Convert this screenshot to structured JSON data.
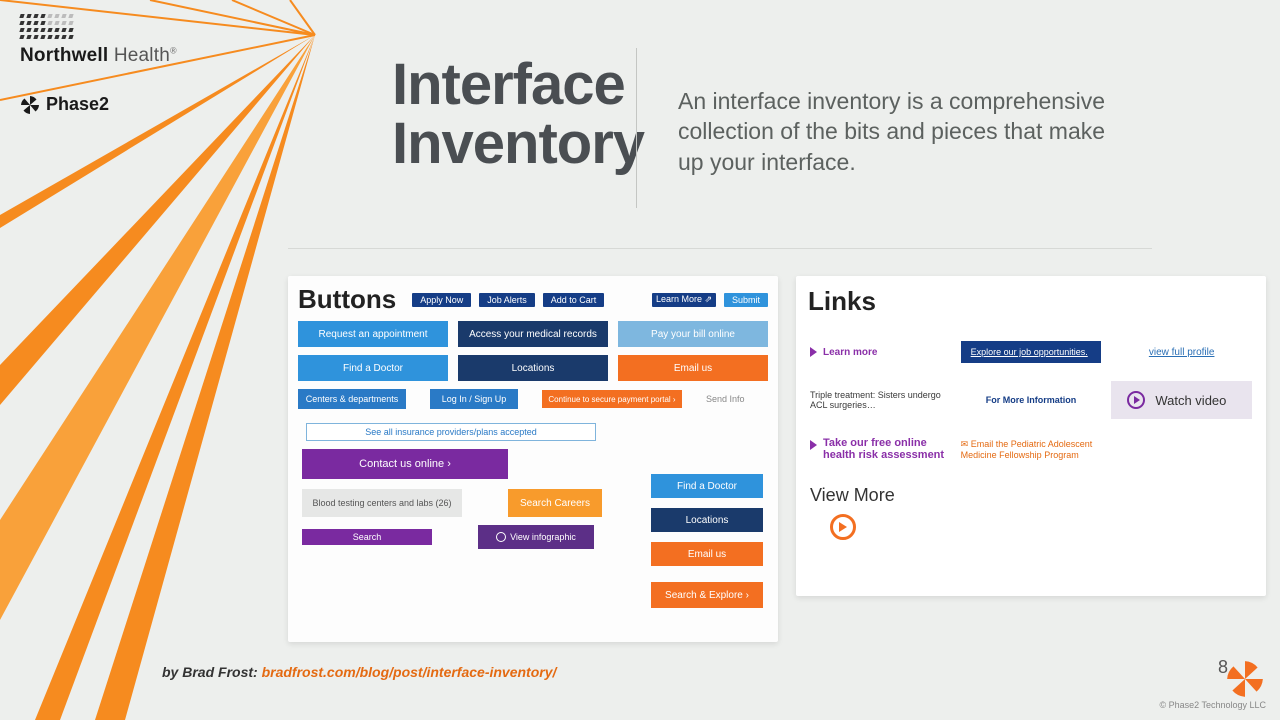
{
  "brand": {
    "northwell_a": "Northwell",
    "northwell_b": " Health",
    "phase2": "Phase2"
  },
  "headline_l1": "Interface",
  "headline_l2": "Inventory",
  "lede": "An interface inventory is a comprehensive collection of the bits and pieces that make up your interface.",
  "buttons_panel": {
    "title": "Buttons",
    "chips": {
      "apply": "Apply Now",
      "alerts": "Job Alerts",
      "cart": "Add to Cart",
      "learn": "Learn More ⇗",
      "submit": "Submit"
    },
    "row1": {
      "appt": "Request an appointment",
      "records": "Access your medical records",
      "bill": "Pay your bill online"
    },
    "row2": {
      "doctor": "Find a Doctor",
      "locations": "Locations",
      "email": "Email us"
    },
    "row3": {
      "centers": "Centers & departments",
      "login": "Log In / Sign Up",
      "portal": "Continue to secure payment portal ›",
      "send": "Send Info"
    },
    "insurance": "See all insurance providers/plans accepted",
    "contact": "Contact us online ›",
    "blood": "Blood testing centers and labs (26)",
    "careers": "Search Careers",
    "search": "Search",
    "infog": "View infographic",
    "side": {
      "doctor": "Find a Doctor",
      "locations": "Locations",
      "email": "Email us",
      "explore": "Search & Explore ›"
    }
  },
  "links_panel": {
    "title": "Links",
    "learn_more": "Learn more",
    "explore_jobs": "Explore our job opportunities.",
    "full_profile": "view full profile",
    "triple": "Triple treatment: Sisters undergo ACL surgeries…",
    "more_info": "For More Information",
    "watch": "Watch video",
    "risk": "Take our free online health risk assessment",
    "fellowship": "✉ Email the Pediatric Adolescent Medicine Fellowship Program",
    "view_more": "View More"
  },
  "credit": {
    "prefix": "by Brad Frost: ",
    "url": "bradfrost.com/blog/post/interface-inventory/"
  },
  "footer": {
    "page": "8",
    "copyright": "© Phase2 Technology LLC"
  }
}
